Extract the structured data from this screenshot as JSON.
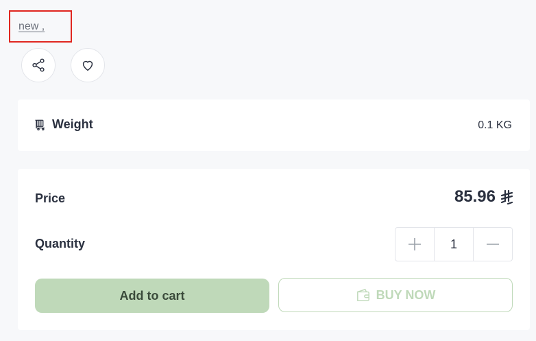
{
  "tag_link": {
    "label": "new ,"
  },
  "actions": {
    "share_icon": "share-icon",
    "favorite_icon": "heart-icon"
  },
  "weight": {
    "label": "Weight",
    "value": "0.1 KG",
    "icon": "weight-cart-icon"
  },
  "price": {
    "label": "Price",
    "value": "85.96",
    "currency_symbol": "⃁",
    "currency_icon": "saudi-riyal-icon"
  },
  "quantity": {
    "label": "Quantity",
    "value": "1"
  },
  "buttons": {
    "add_to_cart": "Add to cart",
    "buy_now": "BUY NOW",
    "buy_now_icon": "wallet-icon"
  },
  "colors": {
    "accent": "#bfd9b9",
    "text": "#2b3140",
    "highlight_border": "#e0261f"
  }
}
